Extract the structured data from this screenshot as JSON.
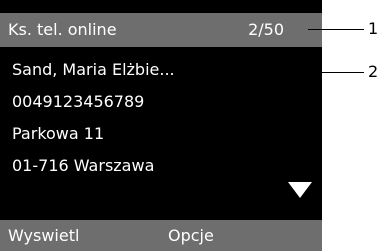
{
  "header": {
    "title": "Ks. tel. online",
    "counter": "2/50"
  },
  "entry": {
    "name": "Sand, Maria Elżbie...",
    "phone": "0049123456789",
    "street": "Parkowa 11",
    "city": "01-716 Warszawa",
    "more_indicator_icon": "triangle-down-icon"
  },
  "softkeys": {
    "left": "Wyswietl",
    "right": "Opcje"
  },
  "callouts": {
    "one": "1",
    "two": "2"
  },
  "colors": {
    "screen_background": "#000000",
    "bar_background": "#6e6e6e",
    "text": "#ffffff"
  }
}
